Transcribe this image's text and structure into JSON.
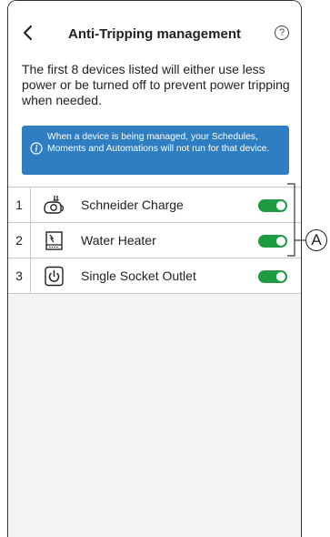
{
  "header": {
    "back_icon": "chevron-left-icon",
    "title": "Anti-Tripping management",
    "help_label": "?"
  },
  "description": "The first 8 devices listed will either use less power or be turned off to prevent power tripping when needed.",
  "info": {
    "icon": "info-icon",
    "text": "When a device is being managed, your Schedules, Moments and Automations will not run for that device."
  },
  "devices": [
    {
      "index": "1",
      "icon": "ev-charger-icon",
      "name": "Schneider Charge",
      "enabled": true
    },
    {
      "index": "2",
      "icon": "water-heater-icon",
      "name": "Water Heater",
      "enabled": true
    },
    {
      "index": "3",
      "icon": "power-socket-icon",
      "name": "Single Socket Outlet",
      "enabled": true
    }
  ],
  "callout": {
    "label": "A"
  },
  "colors": {
    "accent_blue": "#2f7ec1",
    "toggle_on": "#1e9a43"
  }
}
